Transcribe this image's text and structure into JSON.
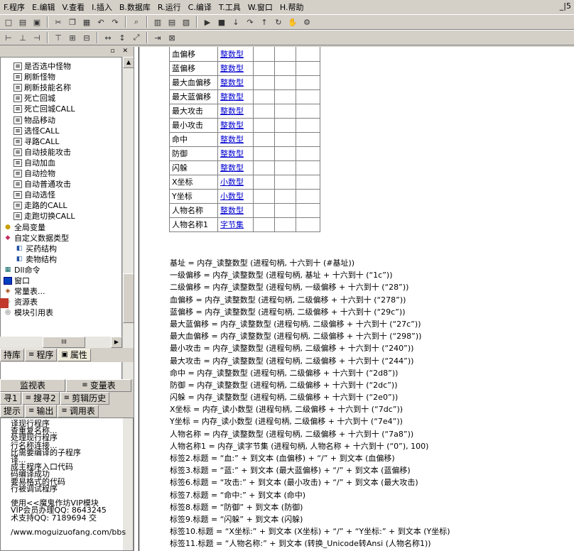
{
  "menu": [
    {
      "key": "F",
      "label": "程序",
      "full": "F.程序"
    },
    {
      "key": "E",
      "label": "编辑",
      "full": "E.编辑"
    },
    {
      "key": "V",
      "label": "查看",
      "full": "V.查看"
    },
    {
      "key": "I",
      "label": "插入",
      "full": "I.插入"
    },
    {
      "key": "B",
      "label": "数据库",
      "full": "B.数据库"
    },
    {
      "key": "R",
      "label": "运行",
      "full": "R.运行"
    },
    {
      "key": "C",
      "label": "编译",
      "full": "C.编译"
    },
    {
      "key": "T",
      "label": "工具",
      "full": "T.工具"
    },
    {
      "key": "W",
      "label": "窗口",
      "full": "W.窗口"
    },
    {
      "key": "H",
      "label": "帮助",
      "full": "H.帮助"
    }
  ],
  "menu_win_ctrl": "_|5",
  "toolbar1_icons": [
    "new-icon",
    "open-icon",
    "save-icon",
    "cut-icon",
    "copy-icon",
    "paste-icon",
    "undo-icon",
    "redo-icon",
    "find-icon",
    "window1-icon",
    "window2-icon",
    "window3-icon",
    "run-icon",
    "stop-icon",
    "step-in-icon",
    "step-over-icon",
    "step-out-icon",
    "step-run-icon",
    "hand-icon",
    "debug-icon"
  ],
  "toolbar2_icons": [
    "align-left-icon",
    "align-center-icon",
    "align-right-icon",
    "align-top-icon",
    "align-mid-icon",
    "align-bottom-icon",
    "same-width-icon",
    "same-height-icon",
    "same-size-icon",
    "tab-order-icon",
    "lock-icon"
  ],
  "tree": {
    "items": [
      {
        "icon": "sub",
        "label": "是否选中怪物"
      },
      {
        "icon": "sub",
        "label": "刷新怪物"
      },
      {
        "icon": "sub",
        "label": "刷新技能名称"
      },
      {
        "icon": "sub",
        "label": "死亡回城"
      },
      {
        "icon": "sub",
        "label": "死亡回城CALL"
      },
      {
        "icon": "sub",
        "label": "物品移动"
      },
      {
        "icon": "sub",
        "label": "选怪CALL"
      },
      {
        "icon": "sub",
        "label": "寻路CALL"
      },
      {
        "icon": "sub",
        "label": "自动技能攻击"
      },
      {
        "icon": "sub",
        "label": "自动加血"
      },
      {
        "icon": "sub",
        "label": "自动捡物"
      },
      {
        "icon": "sub",
        "label": "自动普通攻击"
      },
      {
        "icon": "sub",
        "label": "自动选怪"
      },
      {
        "icon": "sub",
        "label": "走路的CALL"
      },
      {
        "icon": "sub",
        "label": "走跑切换CALL"
      },
      {
        "icon": "glob",
        "label": "全局变量"
      },
      {
        "icon": "type",
        "label": "自定义数据类型"
      },
      {
        "icon": "struct",
        "label": "买药结构"
      },
      {
        "icon": "struct",
        "label": "卖物结构"
      },
      {
        "icon": "dll",
        "label": "Dll命令"
      },
      {
        "icon": "win",
        "label": "窗口"
      },
      {
        "icon": "const",
        "label": "常量表..."
      },
      {
        "icon": "res",
        "label": "资源表"
      },
      {
        "icon": "mod",
        "label": "模块引用表"
      }
    ],
    "hscroll_label": "III"
  },
  "prop_tabs": [
    {
      "label": "持库",
      "active": false
    },
    {
      "label": "程序",
      "active": false
    },
    {
      "label": "属性",
      "active": true
    }
  ],
  "monitor_tabs": [
    {
      "label": "监视表"
    },
    {
      "label": "变量表"
    }
  ],
  "find_tabs": [
    {
      "label": "寻1"
    },
    {
      "label": "搜寻2"
    },
    {
      "label": "剪辑历史"
    }
  ],
  "output_tabs": [
    {
      "label": "提示"
    },
    {
      "label": "输出"
    },
    {
      "label": "调用表"
    }
  ],
  "output_lines": [
    "译现行程序",
    "查重复名称...",
    "处理现行程序",
    "行名称连接...",
    "比需要编译的子程序",
    "译...",
    "成主程序入口代码",
    "码编译成功",
    "要易格式的代码",
    "行被调试程序",
    "",
    "使用<<魔鬼作坊VIP模块",
    "VIP会员办理QQ: 8643245",
    "术支持QQ: 7189694      交",
    "",
    "/www.moguizuofang.com/bbs"
  ],
  "var_table": [
    {
      "name": "血偏移",
      "type": "整数型"
    },
    {
      "name": "蓝偏移",
      "type": "整数型"
    },
    {
      "name": "最大血偏移",
      "type": "整数型"
    },
    {
      "name": "最大蓝偏移",
      "type": "整数型"
    },
    {
      "name": "最大攻击",
      "type": "整数型"
    },
    {
      "name": "最小攻击",
      "type": "整数型"
    },
    {
      "name": "命中",
      "type": "整数型"
    },
    {
      "name": "防御",
      "type": "整数型"
    },
    {
      "name": "闪躲",
      "type": "整数型"
    },
    {
      "name": "X坐标",
      "type": "小数型"
    },
    {
      "name": "Y坐标",
      "type": "小数型"
    },
    {
      "name": "人物名称",
      "type": "整数型"
    },
    {
      "name": "人物名称1",
      "type": "字节集"
    }
  ],
  "code_lines": [
    "基址 = 内存_读整数型 (进程句柄, 十六到十 (#基址))",
    "一级偏移 = 内存_读整数型 (进程句柄, 基址 + 十六到十 (“1c”))",
    "二级偏移 = 内存_读整数型 (进程句柄, 一级偏移 + 十六到十 (“28”))",
    "血偏移 = 内存_读整数型 (进程句柄, 二级偏移 + 十六到十 (“278”))",
    "蓝偏移 = 内存_读整数型 (进程句柄, 二级偏移 + 十六到十 (“29c”))",
    "最大蓝偏移 = 内存_读整数型 (进程句柄, 二级偏移 + 十六到十 (“27c”))",
    "最大血偏移 = 内存_读整数型 (进程句柄, 二级偏移 + 十六到十 (“298”))",
    "最小攻击 = 内存_读整数型 (进程句柄, 二级偏移 + 十六到十 (“240”))",
    "最大攻击 = 内存_读整数型 (进程句柄, 二级偏移 + 十六到十 (“244”))",
    "命中 = 内存_读整数型 (进程句柄, 二级偏移 + 十六到十 (“2d8”))",
    "防御 = 内存_读整数型 (进程句柄, 二级偏移 + 十六到十 (“2dc”))",
    "闪躲 = 内存_读整数型 (进程句柄, 二级偏移 + 十六到十 (“2e0”))",
    "X坐标 = 内存_读小数型 (进程句柄, 二级偏移 + 十六到十 (“7dc”))",
    "Y坐标 = 内存_读小数型 (进程句柄, 二级偏移 + 十六到十 (“7e4”))",
    "人物名称 = 内存_读整数型 (进程句柄, 二级偏移 + 十六到十 (“7a8”))",
    "人物名称1 = 内存_读字节集 (进程句柄, 人物名称 + 十六到十 (“0”), 100)",
    "标签2.标题 = “血:” + 到文本 (血偏移) + “/” + 到文本 (血偏移)",
    "标签3.标题 = “蓝:” + 到文本 (最大蓝偏移) + “/” + 到文本 (蓝偏移)",
    "标签6.标题 = “攻击:” + 到文本 (最小攻击) + “/” + 到文本 (最大攻击)",
    "标签7.标题 = “命中:” + 到文本 (命中)",
    "标签8.标题 = “防御” + 到文本 (防御)",
    "标签9.标题 = “闪躲” + 到文本 (闪躲)",
    "标签10.标题 = “X坐标:” + 到文本 (X坐标) + “/” + “Y坐标:” + 到文本 (Y坐标)",
    "标签11.标题 = “人物名称:” + 到文本 (转换_Unicode转Ansi (人物名称1))"
  ]
}
